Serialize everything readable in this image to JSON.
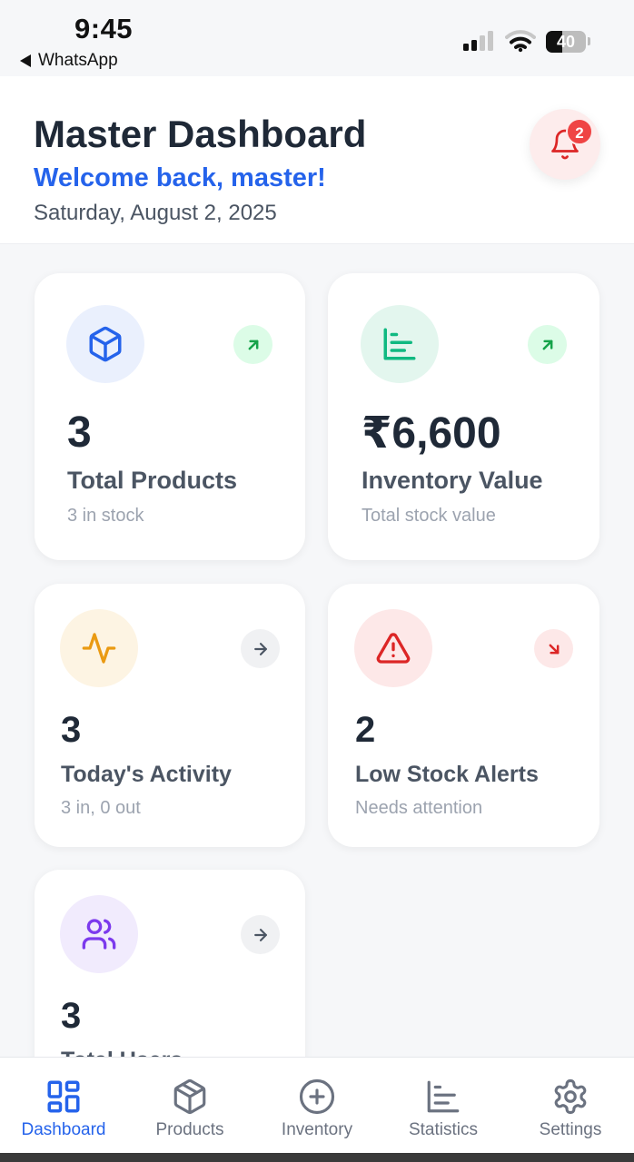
{
  "status_bar": {
    "time": "9:45",
    "back_app": "WhatsApp",
    "battery": "40",
    "battery_level": 0.4
  },
  "header": {
    "title": "Master Dashboard",
    "welcome": "Welcome back, master!",
    "date": "Saturday, August 2, 2025",
    "notification_count": "2"
  },
  "cards": [
    {
      "value": "3",
      "label": "Total Products",
      "sub": "3 in stock",
      "icon": "cube-icon",
      "trend": "up"
    },
    {
      "value": "₹6,600",
      "label": "Inventory Value",
      "sub": "Total stock value",
      "icon": "bar-chart-icon",
      "trend": "up"
    },
    {
      "value": "3",
      "label": "Today's Activity",
      "sub": "3 in, 0 out",
      "icon": "activity-icon",
      "trend": "right"
    },
    {
      "value": "2",
      "label": "Low Stock Alerts",
      "sub": "Needs attention",
      "icon": "warning-icon",
      "trend": "down"
    },
    {
      "value": "3",
      "label": "Total Users",
      "sub": "",
      "icon": "users-icon",
      "trend": "right"
    }
  ],
  "nav": [
    {
      "label": "Dashboard",
      "icon": "grid-icon",
      "active": true
    },
    {
      "label": "Products",
      "icon": "box-icon",
      "active": false
    },
    {
      "label": "Inventory",
      "icon": "plus-circle-icon",
      "active": false
    },
    {
      "label": "Statistics",
      "icon": "bar-chart-icon",
      "active": false
    },
    {
      "label": "Settings",
      "icon": "gear-icon",
      "active": false
    }
  ],
  "colors": {
    "accent": "#2563eb",
    "success": "#16a34a",
    "warning": "#ea9a12",
    "danger": "#dc2626",
    "purple": "#7c3aed"
  }
}
